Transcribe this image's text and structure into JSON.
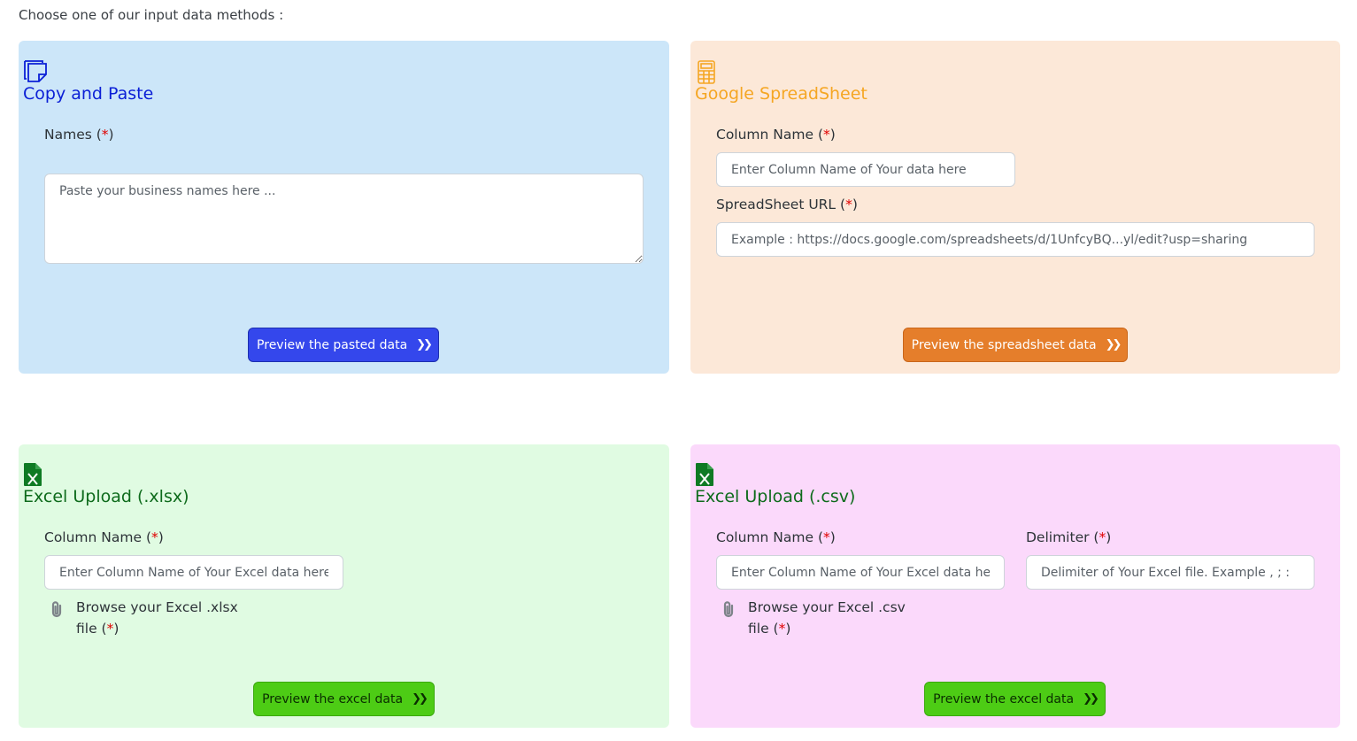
{
  "intro": "Choose one of our input data methods :",
  "required_mark": "*",
  "copy_paste": {
    "title": "Copy and Paste",
    "icon": "sticky-note-icon",
    "names_label": "Names",
    "names_placeholder": "Paste your business names here ...",
    "button": "Preview the pasted data",
    "colors": {
      "bg": "#cce6f9",
      "title": "#0b1fd6",
      "button": "#3447ec"
    }
  },
  "google_sheet": {
    "title": "Google SpreadSheet",
    "icon": "calculator-icon",
    "column_label": "Column Name",
    "column_placeholder": "Enter Column Name of Your data here",
    "url_label": "SpreadSheet URL",
    "url_placeholder": "Example : https://docs.google.com/spreadsheets/d/1UnfcyBQ...yl/edit?usp=sharing",
    "button": "Preview the spreadsheet data",
    "colors": {
      "bg": "#fce8d8",
      "title": "#f5a623",
      "button": "#e57e2b"
    }
  },
  "excel_xlsx": {
    "title": "Excel Upload (.xlsx)",
    "icon": "excel-file-icon",
    "column_label": "Column Name",
    "column_placeholder": "Enter Column Name of Your Excel data here",
    "browse_line1": "Browse your Excel .xlsx",
    "browse_line2": "file",
    "button": "Preview the excel data",
    "colors": {
      "bg": "#e0fbe2",
      "title": "#0e6b1c",
      "button": "#4dcc15"
    }
  },
  "excel_csv": {
    "title": "Excel Upload (.csv)",
    "icon": "excel-file-icon",
    "column_label": "Column Name",
    "column_placeholder": "Enter Column Name of Your Excel data here",
    "delimiter_label": "Delimiter",
    "delimiter_placeholder": "Delimiter of Your Excel file. Example , ; :",
    "browse_line1": "Browse your Excel .csv",
    "browse_line2": "file",
    "button": "Preview the excel data",
    "colors": {
      "bg": "#fbd9fb",
      "title": "#0e6b1c",
      "button": "#4dcc15"
    }
  }
}
